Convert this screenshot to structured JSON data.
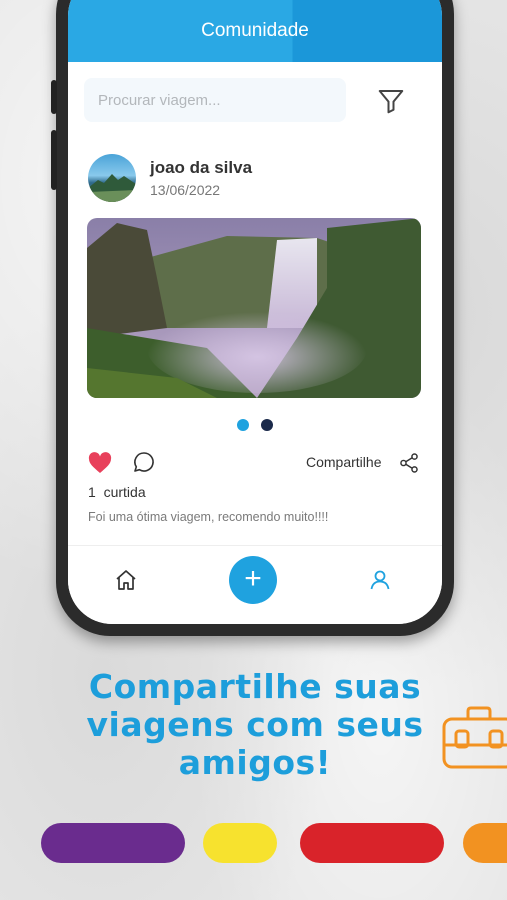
{
  "app": {
    "title": "Comunidade",
    "search_placeholder": "Procurar viagem..."
  },
  "post": {
    "author": "joao da silva",
    "date": "13/06/2022",
    "likes_count": "1",
    "likes_label": "curtida",
    "share_label": "Compartilhe",
    "caption": "Foi uma ótima viagem, recomendo muito!!!!",
    "carousel_active_index": 0,
    "carousel_total": 2
  },
  "bottom_nav": {
    "fab_label": "+"
  },
  "promo": {
    "headline": "Compartilhe suas viagens com seus amigos!"
  },
  "colors": {
    "accent": "#1fa2df",
    "like": "#e8405b",
    "dot_active": "#1fa2df",
    "dot_inactive": "#1b2a4a",
    "pills": [
      "#6a2c8e",
      "#f7e22e",
      "#d9232a",
      "#f29221"
    ]
  },
  "icons": {
    "filter": "filter-icon",
    "like": "heart-icon",
    "comment": "comment-icon",
    "share": "share-icon",
    "home": "home-icon",
    "profile": "user-icon",
    "suitcase": "suitcase-icon"
  }
}
